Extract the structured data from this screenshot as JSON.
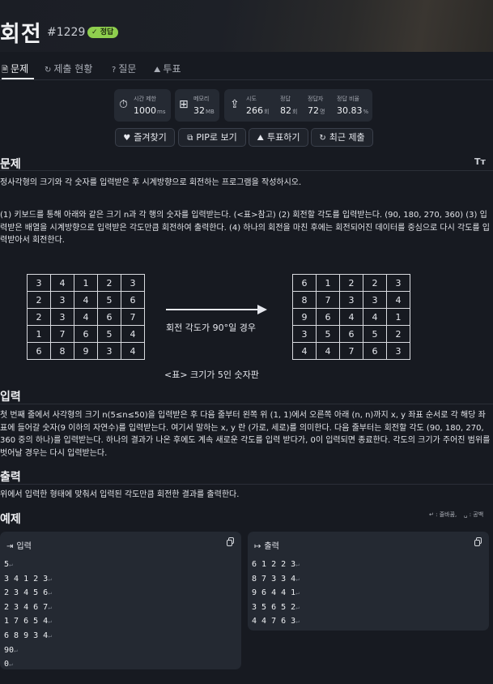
{
  "header": {
    "title": "회전",
    "problem_number": "#1229",
    "badge": "정답"
  },
  "tabs": [
    {
      "icon": "document-icon",
      "glyph": "🗎",
      "label": "문제"
    },
    {
      "icon": "history-icon",
      "glyph": "↻",
      "label": "제출 현황"
    },
    {
      "icon": "question-icon",
      "glyph": "?",
      "label": "질문"
    },
    {
      "icon": "vote-icon",
      "glyph": "⛰",
      "label": "투표"
    }
  ],
  "stats": {
    "time_limit": {
      "label": "시간 제한",
      "value": "1000",
      "unit": "ms"
    },
    "memory": {
      "label": "메모리",
      "value": "32",
      "unit": "MB"
    },
    "tries": {
      "label": "시도",
      "value": "266",
      "unit": "회"
    },
    "correct": {
      "label": "정답",
      "value": "82",
      "unit": "회"
    },
    "solvers": {
      "label": "정답자",
      "value": "72",
      "unit": "명"
    },
    "ratio": {
      "label": "정답 비율",
      "value": "30.83",
      "unit": "%"
    }
  },
  "actions": {
    "favorite": "즐겨찾기",
    "pip": "PIP로 보기",
    "vote": "투표하기",
    "recent": "최근 제출"
  },
  "problem": {
    "title": "문제",
    "text_size_label": "Tт",
    "summary": "정사각형의 크기와 각 숫자를 입력받은 후 시계방향으로 회전하는 프로그램을 작성하시오.",
    "details": "(1) 키보드를 통해 아래와 같은 크기 n과 각 행의 숫자를 입력받는다. (<표>참고) (2) 회전할 각도를 입력받는다. (90, 180, 270, 360) (3) 입력받은 배열을 시계방향으로 입력받은 각도만큼 회전하여 출력한다. (4) 하나의 회전을 마친 후에는 회전되어진 데이터를 중심으로 다시 각도를 입력받아서 회전한다.",
    "table_before": [
      [
        "3",
        "4",
        "1",
        "2",
        "3"
      ],
      [
        "2",
        "3",
        "4",
        "5",
        "6"
      ],
      [
        "2",
        "3",
        "4",
        "6",
        "7"
      ],
      [
        "1",
        "7",
        "6",
        "5",
        "4"
      ],
      [
        "6",
        "8",
        "9",
        "3",
        "4"
      ]
    ],
    "table_after": [
      [
        "6",
        "1",
        "2",
        "2",
        "3"
      ],
      [
        "8",
        "7",
        "3",
        "3",
        "4"
      ],
      [
        "9",
        "6",
        "4",
        "4",
        "1"
      ],
      [
        "3",
        "5",
        "6",
        "5",
        "2"
      ],
      [
        "4",
        "4",
        "7",
        "6",
        "3"
      ]
    ],
    "arrow_caption": "회전 각도가 90°일 경우",
    "table_caption": "<표> 크기가 5인 숫자판"
  },
  "input_section": {
    "title": "입력",
    "text": "첫 번째 줄에서 사각형의 크기 n(5≤n≤50)을 입력받은 후 다음 줄부터 왼쪽 위 (1, 1)에서 오른쪽 아래 (n, n)까지 x, y 좌표 순서로 각 해당 좌표에 들어갈 숫자(9 이하의 자연수)를 입력받는다. 여기서 말하는 x, y 란 (가로, 세로)를 의미한다. 다음 줄부터는 회전할 각도 (90, 180, 270, 360 중의 하나)를 입력받는다. 하나의 결과가 나온 후에도 계속 새로운 각도를 입력 받다가, 0이 입력되면 종료한다. 각도의 크기가 주어진 범위를 벗어날 경우는 다시 입력받는다."
  },
  "output_section": {
    "title": "출력",
    "text": "위에서 입력한 형태에 맞춰서 입력된 각도만큼 회전한 결과를 출력한다."
  },
  "example": {
    "title": "예제",
    "legend_newline": ": 줄바꿈,",
    "legend_space": ": 공백",
    "input_label": "입력",
    "output_label": "출력",
    "input_lines": [
      "5",
      "3 4 1 2 3",
      "2 3 4 5 6",
      "2 3 4 6 7",
      "1 7 6 5 4",
      "6 8 9 3 4",
      "90",
      "0"
    ],
    "output_lines": [
      "6 1 2 2 3",
      "8 7 3 3 4",
      "9 6 4 4 1",
      "3 5 6 5 2",
      "4 4 7 6 3"
    ]
  }
}
